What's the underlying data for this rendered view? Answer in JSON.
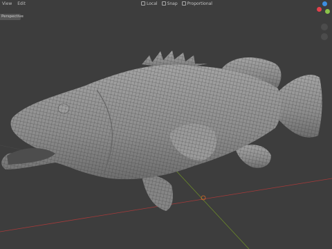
{
  "menu": {
    "view_label": "View",
    "edit_label": "Edit"
  },
  "mode": {
    "label": "Perspective"
  },
  "header_tools": {
    "tool1_label": "Local",
    "tool2_label": "Snap",
    "tool3_label": "Proportional"
  },
  "colors": {
    "background": "#3d3d3d",
    "model_fill": "#8f8f8f",
    "wire": "#2a2a2a",
    "x_axis": "#a83a3a",
    "y_axis": "#6b8a2a",
    "gizmo_x": "#e2414b",
    "gizmo_y": "#8bc34a",
    "gizmo_z": "#3d8fe0"
  }
}
